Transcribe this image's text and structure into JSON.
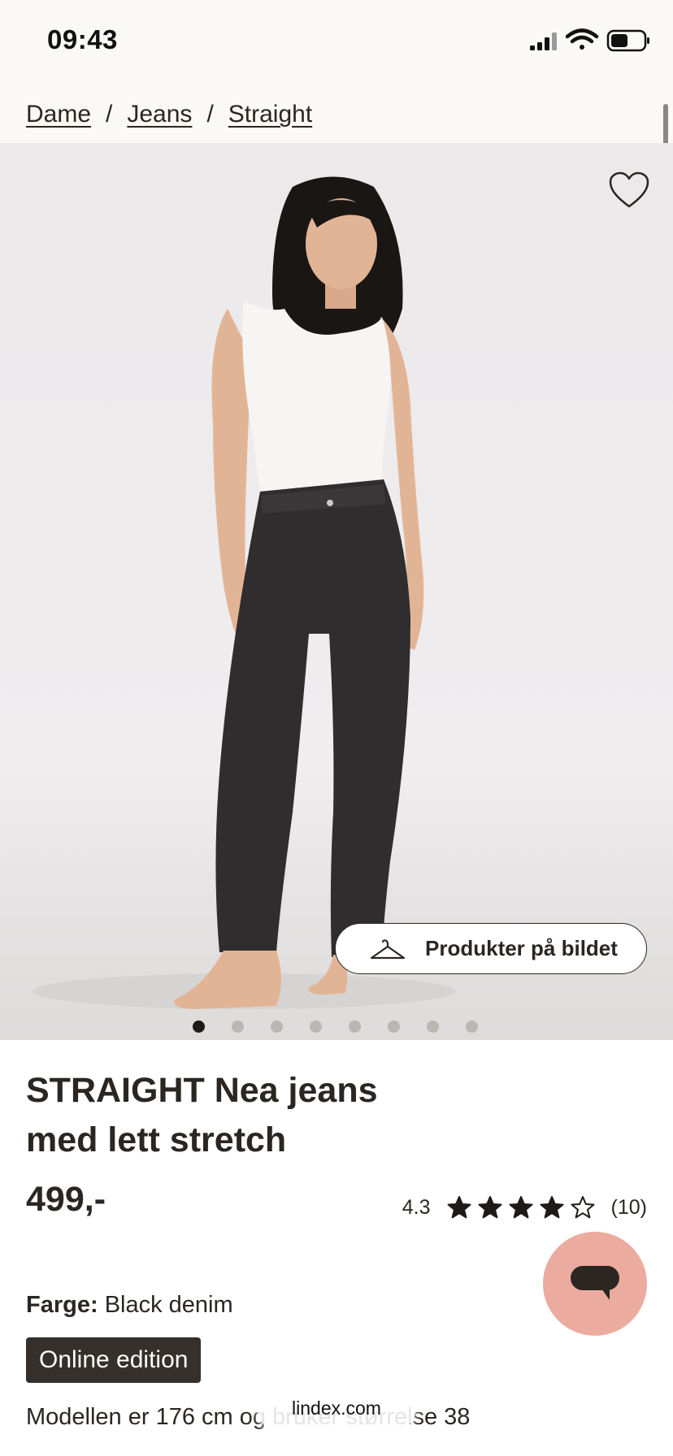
{
  "status_bar": {
    "time": "09:43"
  },
  "breadcrumb": {
    "items": [
      "Dame",
      "Jeans",
      "Straight"
    ],
    "separator": "/"
  },
  "gallery": {
    "slide_count": 8,
    "active_index": 0,
    "products_button": "Produkter på bildet"
  },
  "product": {
    "title_line1": "STRAIGHT Nea jeans",
    "title_line2": "med lett stretch",
    "price": "499,-",
    "rating": {
      "value": "4.3",
      "stars_filled": 4,
      "stars_total": 5,
      "count": "(10)"
    },
    "color_label": "Farge:",
    "color_value": "Black denim",
    "badge": "Online edition",
    "model_info": "Modellen er 176 cm og bruker størrelse 38"
  },
  "browser": {
    "url": "lindex.com"
  },
  "colors": {
    "accent_chat": "#ecab9f",
    "text_dark": "#2b2622",
    "badge_bg": "#35302b",
    "page_bg": "#faf9f6"
  },
  "icons": [
    "signal-icon",
    "wifi-icon",
    "battery-icon",
    "heart-icon",
    "hanger-icon",
    "star-icon",
    "chat-icon"
  ]
}
